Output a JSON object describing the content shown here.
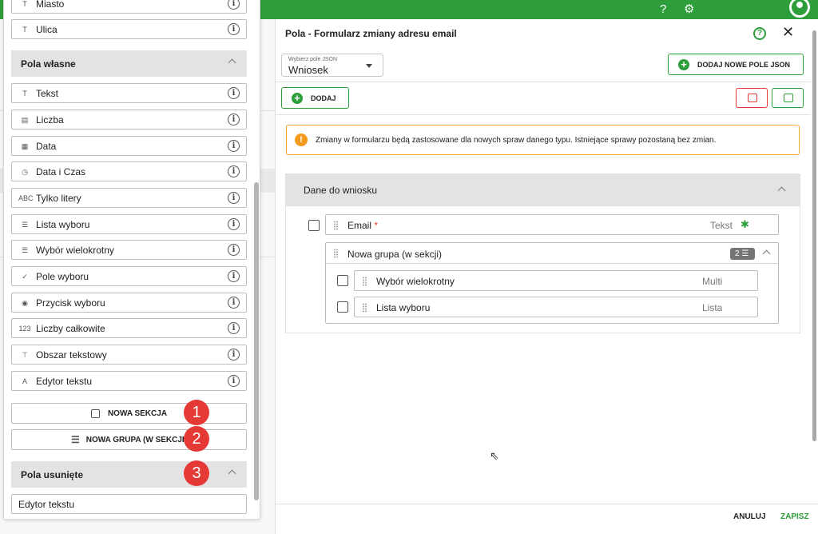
{
  "palette": {
    "partial_top_label": "Miasto",
    "street": "Ulica",
    "custom_section": "Pola własne",
    "custom_fields": [
      {
        "label": "Tekst",
        "icon": "T"
      },
      {
        "label": "Liczba",
        "icon": "▤"
      },
      {
        "label": "Data",
        "icon": "▦"
      },
      {
        "label": "Data i Czas",
        "icon": "◷"
      },
      {
        "label": "Tylko litery",
        "icon": "ABC"
      },
      {
        "label": "Lista wyboru",
        "icon": "☰"
      },
      {
        "label": "Wybór wielokrotny",
        "icon": "☰"
      },
      {
        "label": "Pole wyboru",
        "icon": "✓"
      },
      {
        "label": "Przycisk wyboru",
        "icon": "◉"
      },
      {
        "label": "Liczby całkowite",
        "icon": "123"
      },
      {
        "label": "Obszar tekstowy",
        "icon": "⊤"
      },
      {
        "label": "Edytor tekstu",
        "icon": "A"
      }
    ],
    "new_section": "NOWA SEKCJA",
    "new_group": "NOWA GRUPA (W SEKCJI)",
    "removed_section": "Pola usunięte",
    "removed_fields": [
      "Edytor tekstu"
    ],
    "badges": [
      "1",
      "2",
      "3"
    ]
  },
  "dialog": {
    "title": "Pola - Formularz zmiany adresu email",
    "select_label": "Wybierz pole JSON",
    "select_value": "Wniosek",
    "add_json_field": "DODAJ NOWE POLE JSON",
    "add": "DODAJ",
    "alert": "Zmiany w formularzu będą zastosowane dla nowych spraw danego typu. Istniejące sprawy pozostaną bez zmian.",
    "section_title": "Dane do wniosku",
    "email_field": {
      "label": "Email",
      "required_mark": "*",
      "type": "Tekst"
    },
    "group": {
      "label": "Nowa grupa (w sekcji)",
      "count": "2"
    },
    "group_fields": [
      {
        "label": "Wybór wielokrotny",
        "type": "Multi"
      },
      {
        "label": "Lista wyboru",
        "type": "Lista"
      }
    ],
    "cancel": "ANULUJ",
    "save": "ZAPISZ"
  },
  "colors": {
    "brand_green": "#2e9e3a",
    "badge_red": "#e53935",
    "alert_orange": "#f39a1d"
  }
}
